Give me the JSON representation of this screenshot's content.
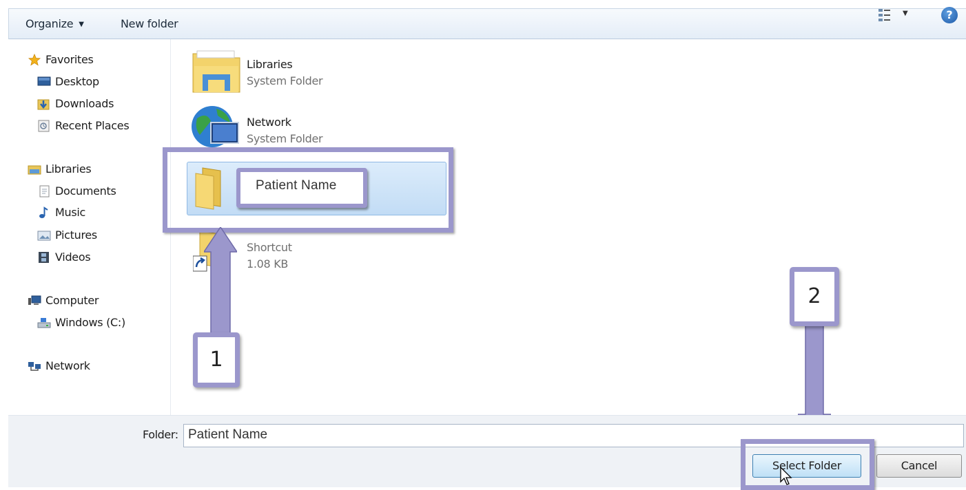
{
  "toolbar": {
    "organize_label": "Organize",
    "new_folder_label": "New folder"
  },
  "nav": {
    "favorites": {
      "label": "Favorites",
      "items": [
        "Desktop",
        "Downloads",
        "Recent Places"
      ]
    },
    "libraries": {
      "label": "Libraries",
      "items": [
        "Documents",
        "Music",
        "Pictures",
        "Videos"
      ]
    },
    "computer": {
      "label": "Computer",
      "items": [
        "Windows (C:)"
      ]
    },
    "network": {
      "label": "Network"
    }
  },
  "files": [
    {
      "name": "Libraries",
      "subtitle": "System Folder",
      "icon": "libraries-icon"
    },
    {
      "name": "Network",
      "subtitle": "System Folder",
      "icon": "network-globe-icon"
    },
    {
      "name": "Patient Name",
      "subtitle": "",
      "icon": "folder-icon",
      "selected": true
    },
    {
      "name": "Shortcut",
      "subtitle": "1.08 KB",
      "icon": "shortcut-icon"
    }
  ],
  "rename_value": "Patient Name",
  "callouts": {
    "step1": "1",
    "step2": "2"
  },
  "bottom": {
    "folder_label": "Folder:",
    "folder_value": "Patient Name",
    "select_button": "Select Folder",
    "cancel_button": "Cancel"
  },
  "colors": {
    "annotation": "#9b97cc",
    "selection": "#c2dcf5"
  }
}
